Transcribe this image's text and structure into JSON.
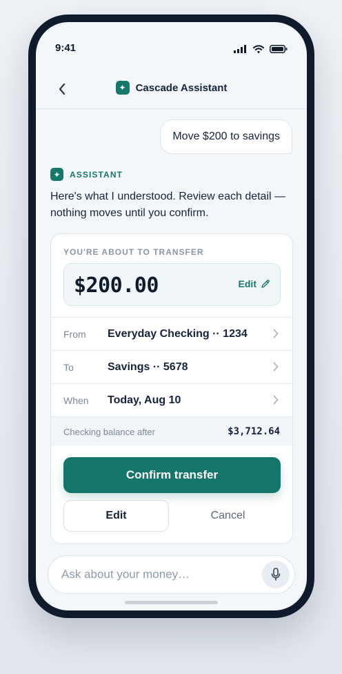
{
  "status_bar": {
    "time": "9:41",
    "signal_icon": "signal-bars-icon",
    "wifi_icon": "wifi-icon",
    "battery_icon": "battery-icon"
  },
  "header": {
    "title": "Cascade Assistant",
    "back_icon": "chevron-left-icon",
    "brand_icon": "sparkle-icon"
  },
  "chat": {
    "user_message": "Move $200 to savings",
    "assistant_label": "ASSISTANT",
    "assistant_message": "Here's what I understood. Review each detail — nothing moves until you confirm."
  },
  "transfer_card": {
    "kicker": "YOU'RE ABOUT TO TRANSFER",
    "amount": "$200.00",
    "amount_edit_label": "Edit",
    "rows": [
      {
        "key": "From",
        "value": "Everyday Checking ·· 1234"
      },
      {
        "key": "To",
        "value": "Savings ·· 5678"
      },
      {
        "key": "When",
        "value": "Today, Aug 10"
      }
    ],
    "balance_label": "Checking balance after",
    "balance_value": "$3,712.64",
    "confirm_label": "Confirm transfer",
    "edit_label": "Edit",
    "cancel_label": "Cancel"
  },
  "composer": {
    "placeholder": "Ask about your money…",
    "mic_icon": "microphone-icon"
  },
  "colors": {
    "accent": "#14766a",
    "text": "#16233a",
    "background": "#f3f7fa",
    "frame": "#0f1b2d"
  }
}
